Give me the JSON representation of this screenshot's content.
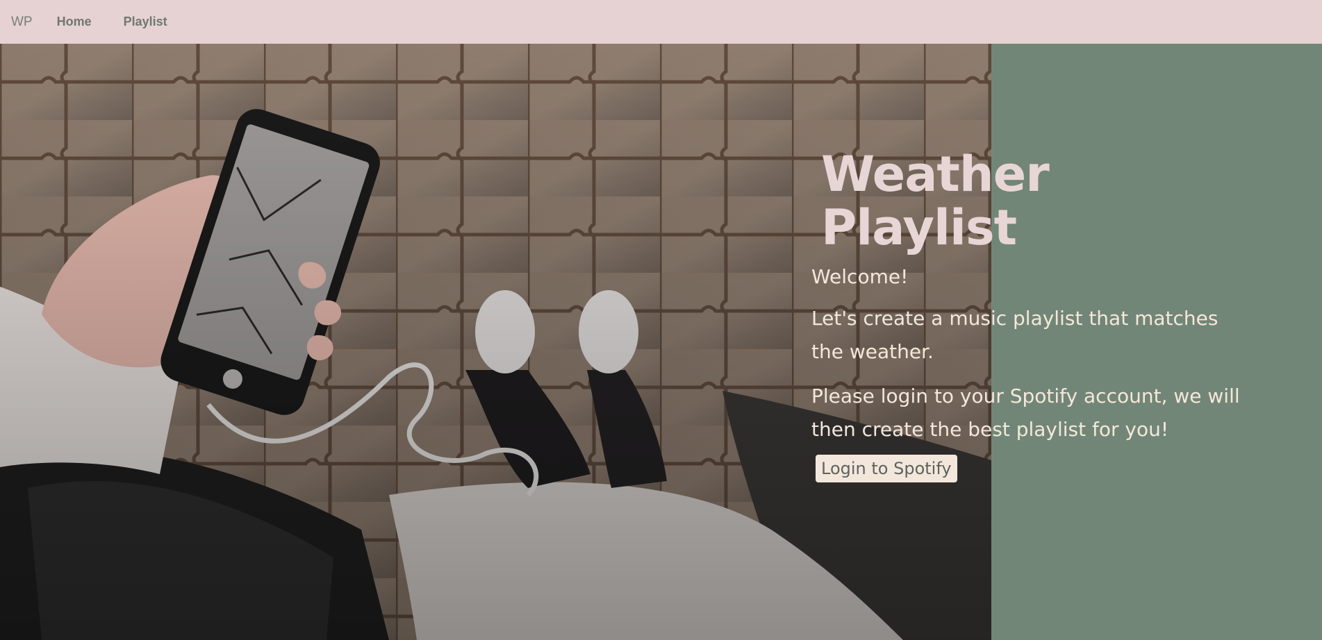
{
  "nav": {
    "brand": "WP",
    "links": [
      {
        "label": "Home"
      },
      {
        "label": "Playlist"
      }
    ]
  },
  "hero": {
    "image_description": "overhead-phone-and-sneakers-photo",
    "title": "Weather Playlist",
    "welcome": "Welcome!",
    "intro": "Let's create a music playlist that matches the weather.",
    "instructions": "Please login to your Spotify account, we will then create the best playlist for you!",
    "login_button": "Login to Spotify"
  },
  "colors": {
    "navbar_bg": "#e6d2d2",
    "panel_bg": "#728677",
    "title": "#e8d6d6",
    "text": "#f3e8dc",
    "button_bg": "#f3e7dc",
    "button_text": "#5f625f"
  }
}
